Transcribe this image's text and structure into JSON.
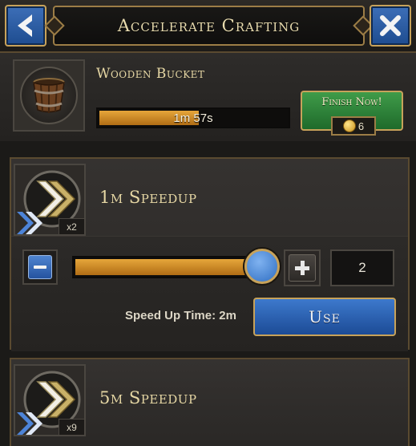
{
  "header": {
    "title": "Accelerate Crafting"
  },
  "crafting": {
    "item_name": "Wooden Bucket",
    "time_remaining": "1m 57s",
    "progress_fraction": 0.53,
    "finish_label": "Finish Now!",
    "finish_cost": "6"
  },
  "speedups": [
    {
      "name": "1m Speedup",
      "quantity": "x2",
      "selected_count": "2",
      "slider_fraction": 1.0,
      "speed_up_time": "Speed Up Time: 2m",
      "use_label": "Use"
    },
    {
      "name": "5m Speedup",
      "quantity": "x9"
    }
  ],
  "colors": {
    "accent_gold": "#c7a25a",
    "button_blue": "#2f6ec2",
    "button_green": "#2f8a3b",
    "progress_orange": "#d08a22"
  },
  "icons": {
    "back": "chevron-left-icon",
    "close": "close-icon",
    "item": "bucket-icon",
    "coin": "coin-icon",
    "speedup": "double-chevron-icon"
  }
}
